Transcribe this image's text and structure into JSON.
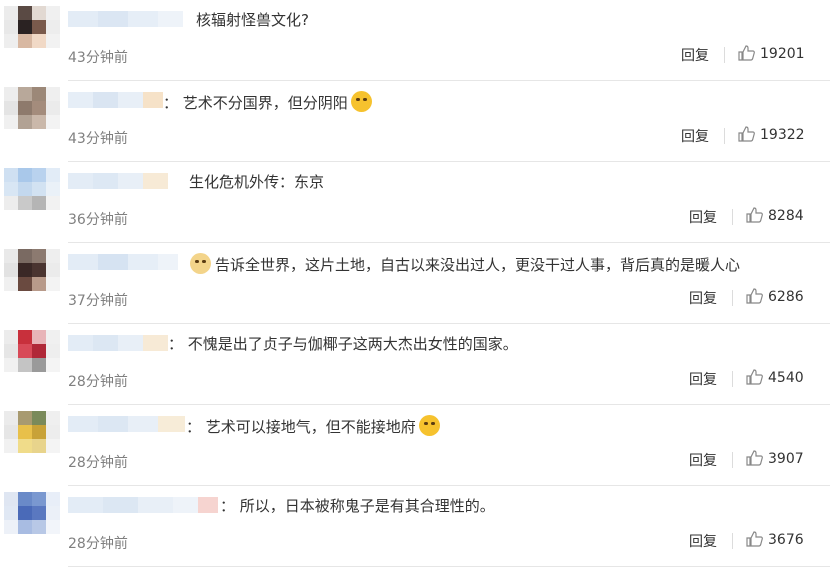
{
  "actions": {
    "reply_label": "回复"
  },
  "icons": {
    "like": "thumbs-up-icon",
    "emoji": "emoji-icon"
  },
  "comments": [
    {
      "text": "核辐射怪兽文化?",
      "time": "43分钟前",
      "likes": "19201"
    },
    {
      "text": "：  艺术不分国界，但分阴阳",
      "time": "43分钟前",
      "likes": "19322"
    },
    {
      "text": "生化危机外传：东京",
      "time": "36分钟前",
      "likes": "8284"
    },
    {
      "text": "告诉全世界，这片土地，自古以来没出过人，更没干过人事，背后真的是暖人心",
      "time": "37分钟前",
      "likes": "6286"
    },
    {
      "text": "：  不愧是出了贞子与伽椰子这两大杰出女性的国家。",
      "time": "28分钟前",
      "likes": "4540"
    },
    {
      "text": "：  艺术可以接地气，但不能接地府",
      "time": "28分钟前",
      "likes": "3907"
    },
    {
      "text": "：  所以，日本被称鬼子是有其合理性的。",
      "time": "28分钟前",
      "likes": "3676"
    }
  ]
}
